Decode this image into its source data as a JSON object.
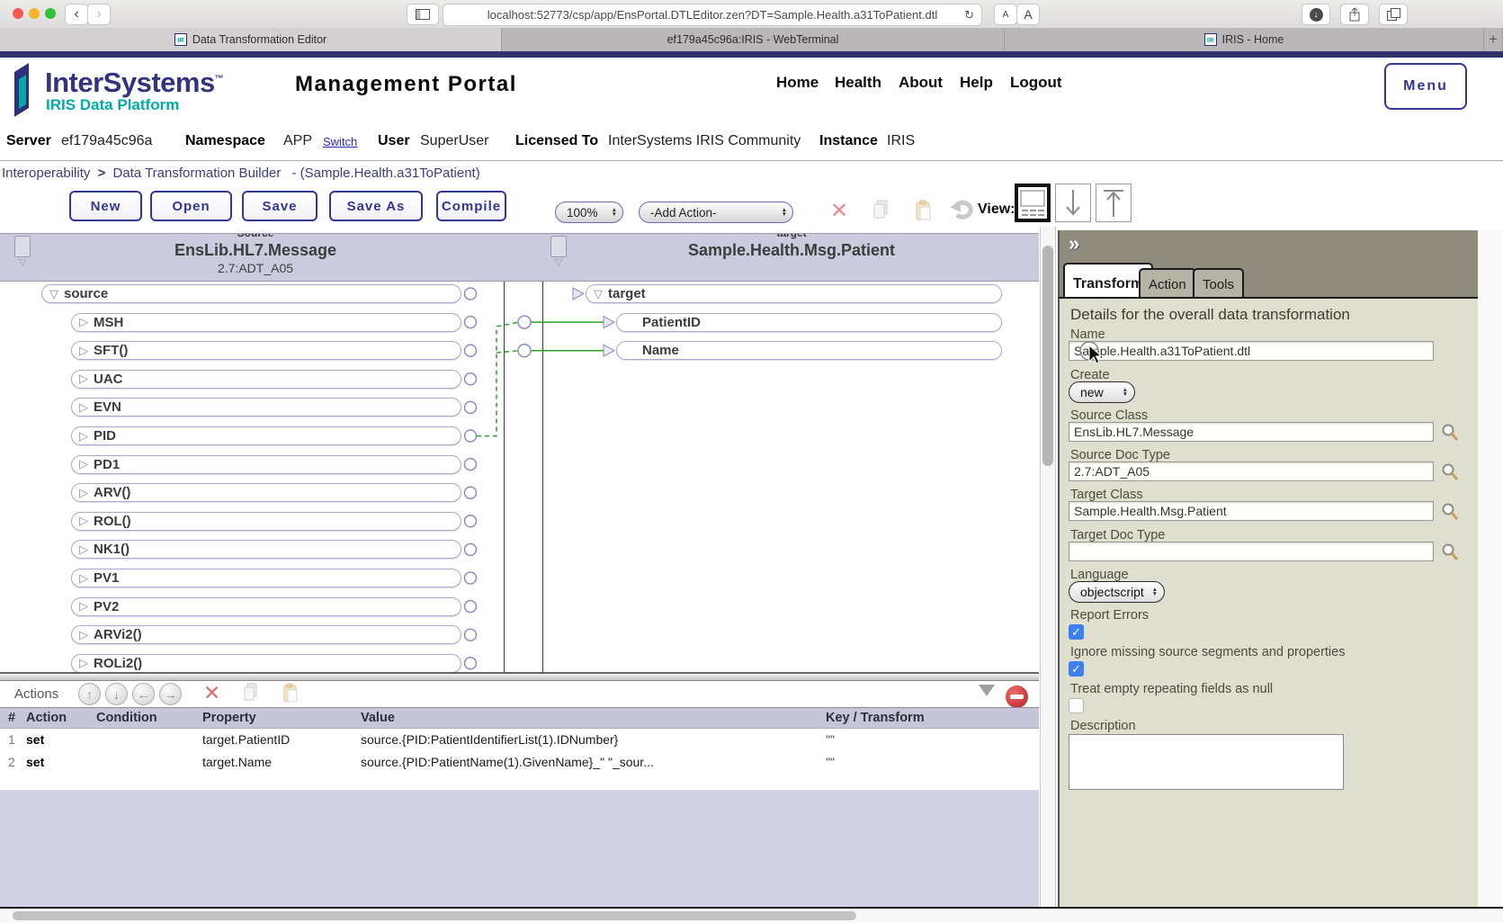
{
  "colors": {
    "accent_navy": "#333695",
    "brand_teal": "#00ABA5",
    "link_blue": "#2929c8",
    "connector_green": "#2f9e2f",
    "band_lavender": "#cbcbdd",
    "panel_olive": "#dfdfd0",
    "strip_olive": "#8f8c7e",
    "checkbox_blue": "#3d7ff0",
    "table_header_lavender": "#c6c6d8",
    "bottom_lavender": "#d1d1e3"
  },
  "browser": {
    "url": "localhost:52773/csp/app/EnsPortal.DTLEditor.zen?DT=Sample.Health.a31ToPatient.dtl",
    "tabs": [
      {
        "title": "Data Transformation Editor",
        "favicon": "IR"
      },
      {
        "title": "ef179a45c96a:IRIS - WebTerminal",
        "favicon": ""
      },
      {
        "title": "IRIS - Home",
        "favicon": "IR"
      }
    ],
    "new_tab_label": "+",
    "font_buttons": {
      "small": "A",
      "large": "A"
    }
  },
  "header": {
    "logo_title": "InterSystems",
    "logo_tm": "™",
    "logo_subtitle": "IRIS Data Platform",
    "portal_title": "Management Portal",
    "nav": [
      "Home",
      "Health",
      "About",
      "Help",
      "Logout"
    ],
    "menu_button": "Menu"
  },
  "info_bar": {
    "server_label": "Server",
    "server_value": "ef179a45c96a",
    "namespace_label": "Namespace",
    "namespace_value": "APP",
    "switch_link": "Switch",
    "user_label": "User",
    "user_value": "SuperUser",
    "licensed_label": "Licensed To",
    "licensed_value": "InterSystems IRIS Community",
    "instance_label": "Instance",
    "instance_value": "IRIS"
  },
  "breadcrumb": {
    "root": "Interoperability",
    "separator": ">",
    "page": "Data Transformation Builder",
    "suffix": "- (Sample.Health.a31ToPatient)"
  },
  "toolbar": {
    "buttons": [
      "New",
      "Open",
      "Save",
      "Save As",
      "Compile"
    ],
    "zoom_select": "100%",
    "add_action_select": "-Add Action-",
    "view_label": "View:"
  },
  "diagram": {
    "source_panel": {
      "clipped_label": "Source",
      "title": "EnsLib.HL7.Message",
      "subtitle": "2.7:ADT_A05",
      "root": "source",
      "nodes": [
        "MSH",
        "SFT()",
        "UAC",
        "EVN",
        "PID",
        "PD1",
        "ARV()",
        "ROL()",
        "NK1()",
        "PV1",
        "PV2",
        "ARVi2()",
        "ROLi2()"
      ]
    },
    "target_panel": {
      "clipped_label": "target",
      "title": "Sample.Health.Msg.Patient",
      "subtitle": "",
      "root": "target",
      "nodes": [
        "PatientID",
        "Name"
      ]
    }
  },
  "actions_panel": {
    "title": "Actions",
    "columns": [
      "#",
      "Action",
      "Condition",
      "Property",
      "Value",
      "Key / Transform"
    ],
    "rows": [
      {
        "num": "1",
        "action": "set",
        "condition": "",
        "property": "target.PatientID",
        "value": "source.{PID:PatientIdentifierList(1).IDNumber}",
        "key": "\"\""
      },
      {
        "num": "2",
        "action": "set",
        "condition": "",
        "property": "target.Name",
        "value": "source.{PID:PatientName(1).GivenName}_\" \"_sour...",
        "key": "\"\""
      }
    ]
  },
  "side_panel": {
    "collapse_glyph": "»",
    "tabs": [
      "Transform",
      "Action",
      "Tools"
    ],
    "active_tab": "Transform",
    "heading": "Details for the overall data transformation",
    "fields": {
      "name_label": "Name",
      "name_value": "Sample.Health.a31ToPatient.dtl",
      "create_label": "Create",
      "create_value": "new",
      "source_class_label": "Source Class",
      "source_class_value": "EnsLib.HL7.Message",
      "source_doc_label": "Source Doc Type",
      "source_doc_value": "2.7:ADT_A05",
      "target_class_label": "Target Class",
      "target_class_value": "Sample.Health.Msg.Patient",
      "target_doc_label": "Target Doc Type",
      "target_doc_value": "",
      "language_label": "Language",
      "language_value": "objectscript",
      "report_errors_label": "Report Errors",
      "ignore_label": "Ignore missing source segments and properties",
      "treat_label": "Treat empty repeating fields as null",
      "description_label": "Description",
      "description_value": ""
    }
  }
}
